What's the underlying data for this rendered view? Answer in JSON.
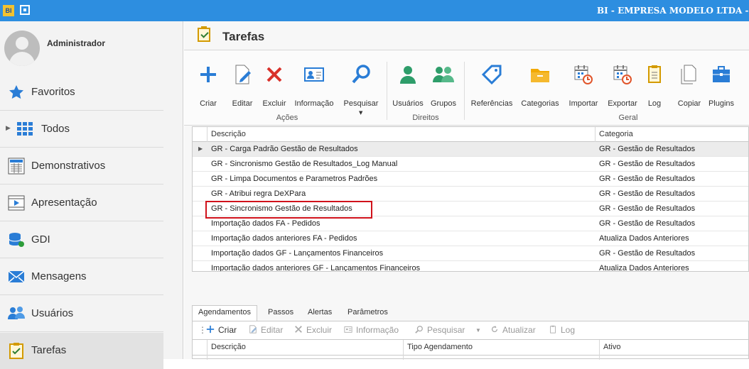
{
  "titlebar": {
    "logo": "BI",
    "title": "BI - EMPRESA MODELO LTDA - Bas"
  },
  "user": {
    "name": "Administrador"
  },
  "sidebar": {
    "items": [
      {
        "label": "Favoritos",
        "icon": "star-icon"
      },
      {
        "label": "Todos",
        "icon": "grid-icon"
      },
      {
        "label": "Demonstrativos",
        "icon": "report-icon"
      },
      {
        "label": "Apresentação",
        "icon": "presentation-icon"
      },
      {
        "label": "GDI",
        "icon": "database-icon"
      },
      {
        "label": "Mensagens",
        "icon": "mail-icon"
      },
      {
        "label": "Usuários",
        "icon": "users-icon"
      },
      {
        "label": "Tarefas",
        "icon": "clipboard-check-icon"
      }
    ]
  },
  "page": {
    "title": "Tarefas"
  },
  "ribbon": {
    "buttons": [
      {
        "label": "Criar",
        "icon": "plus-icon"
      },
      {
        "label": "Editar",
        "icon": "edit-icon"
      },
      {
        "label": "Excluir",
        "icon": "delete-icon"
      },
      {
        "label": "Informação",
        "icon": "info-card-icon"
      },
      {
        "label": "Pesquisar",
        "icon": "search-icon"
      },
      {
        "label": "Usuários",
        "icon": "user-icon"
      },
      {
        "label": "Grupos",
        "icon": "group-icon"
      },
      {
        "label": "Referências",
        "icon": "tag-icon"
      },
      {
        "label": "Categorias",
        "icon": "folder-icon"
      },
      {
        "label": "Importar",
        "icon": "import-calendar-icon"
      },
      {
        "label": "Exportar",
        "icon": "export-calendar-icon"
      },
      {
        "label": "Log",
        "icon": "log-icon"
      },
      {
        "label": "Copiar",
        "icon": "copy-icon"
      },
      {
        "label": "Plugins",
        "icon": "plugin-briefcase-icon"
      }
    ],
    "groups": {
      "acoes": "Ações",
      "direitos": "Direitos",
      "geral": "Geral"
    },
    "accent": "#2d8ee0"
  },
  "grid": {
    "columns": [
      "Descrição",
      "Categoria"
    ],
    "rows": [
      {
        "descricao": "GR - Carga Padrão Gestão de Resultados",
        "categoria": "GR - Gestão de Resultados"
      },
      {
        "descricao": "GR - Sincronismo Gestão de Resultados_Log Manual",
        "categoria": "GR - Gestão de Resultados"
      },
      {
        "descricao": "GR - Limpa Documentos e Parametros Padrões",
        "categoria": "GR - Gestão de Resultados"
      },
      {
        "descricao": "GR - Atribui regra DeXPara",
        "categoria": "GR - Gestão de Resultados"
      },
      {
        "descricao": "GR - Sincronismo Gestão de Resultados",
        "categoria": "GR - Gestão de Resultados"
      },
      {
        "descricao": "Importação dados FA - Pedidos",
        "categoria": "GR - Gestão de Resultados"
      },
      {
        "descricao": "Importação dados anteriores FA - Pedidos",
        "categoria": "Atualiza Dados Anteriores"
      },
      {
        "descricao": "Importação dados GF - Lançamentos Financeiros",
        "categoria": "GR - Gestão de Resultados"
      },
      {
        "descricao": "Importação dados anteriores GF - Lançamentos Financeiros",
        "categoria": "Atualiza Dados Anteriores"
      }
    ],
    "highlight_color": "#d0121b"
  },
  "bottom": {
    "tabs": [
      "Agendamentos",
      "Passos",
      "Alertas",
      "Parâmetros"
    ],
    "toolbar": {
      "criar": "Criar",
      "editar": "Editar",
      "excluir": "Excluir",
      "informacao": "Informação",
      "pesquisar": "Pesquisar",
      "atualizar": "Atualizar",
      "log": "Log"
    },
    "columns": [
      "Descrição",
      "Tipo Agendamento",
      "Ativo"
    ]
  }
}
